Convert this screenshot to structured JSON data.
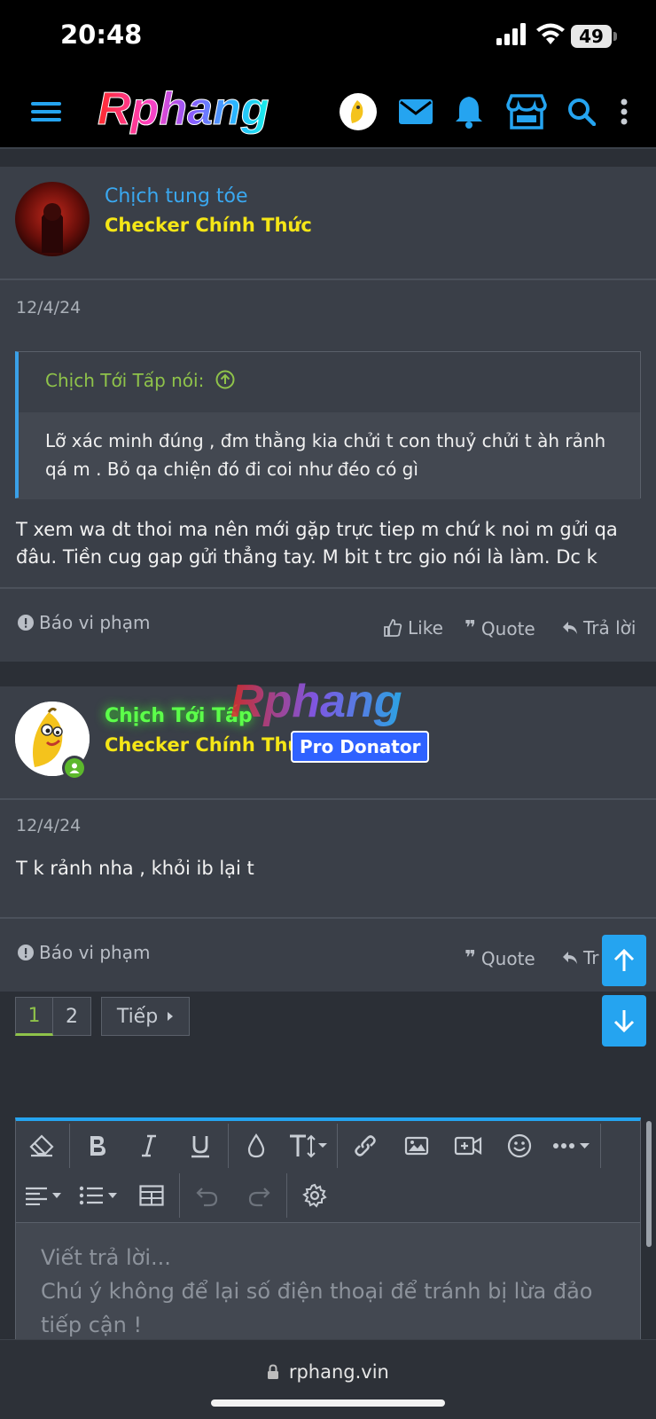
{
  "status": {
    "time": "20:48",
    "battery": "49"
  },
  "brand": {
    "logo_text": "Rphang",
    "watermark_text": "Rphang",
    "accent": "#25a4f0"
  },
  "posts": [
    {
      "username": "Chịch tung tóe",
      "username_color": "#3aa8f0",
      "title": "Checker Chính Thức",
      "date": "12/4/24",
      "quote": {
        "author": "Chịch Tới Tấp nói:",
        "text": "Lỡ xác minh đúng , đm thằng kia chửi t con thuỷ chửi t àh rảnh qá m . Bỏ qa chiện đó đi coi như đéo có gì"
      },
      "message": "T xem wa dt thoi ma nên mới gặp trực tiep m chứ k noi m gửi qa đâu. Tiền cug gap gửi thẳng tay. M bit t trc gio nói là làm. Dc k",
      "actions": {
        "report": "Báo vi phạm",
        "like": "Like",
        "quote": "Quote",
        "reply": "Trả lời"
      }
    },
    {
      "username": "Chịch Tới Tấp",
      "username_color": "#5cff4a",
      "title": "Checker Chính Thức",
      "badge": "Pro Donator",
      "date": "12/4/24",
      "message": "T k rảnh nha , khỏi ib lại t",
      "actions": {
        "report": "Báo vi phạm",
        "quote": "Quote",
        "reply_partial": "Tr"
      }
    }
  ],
  "pagination": {
    "pages": [
      "1",
      "2"
    ],
    "next": "Tiếp"
  },
  "editor": {
    "placeholder": "Viết trả lời...\nChú ý không để lại số điện thoại để tránh bị lừa đảo tiếp cận !"
  },
  "browser": {
    "url": "rphang.vin"
  }
}
